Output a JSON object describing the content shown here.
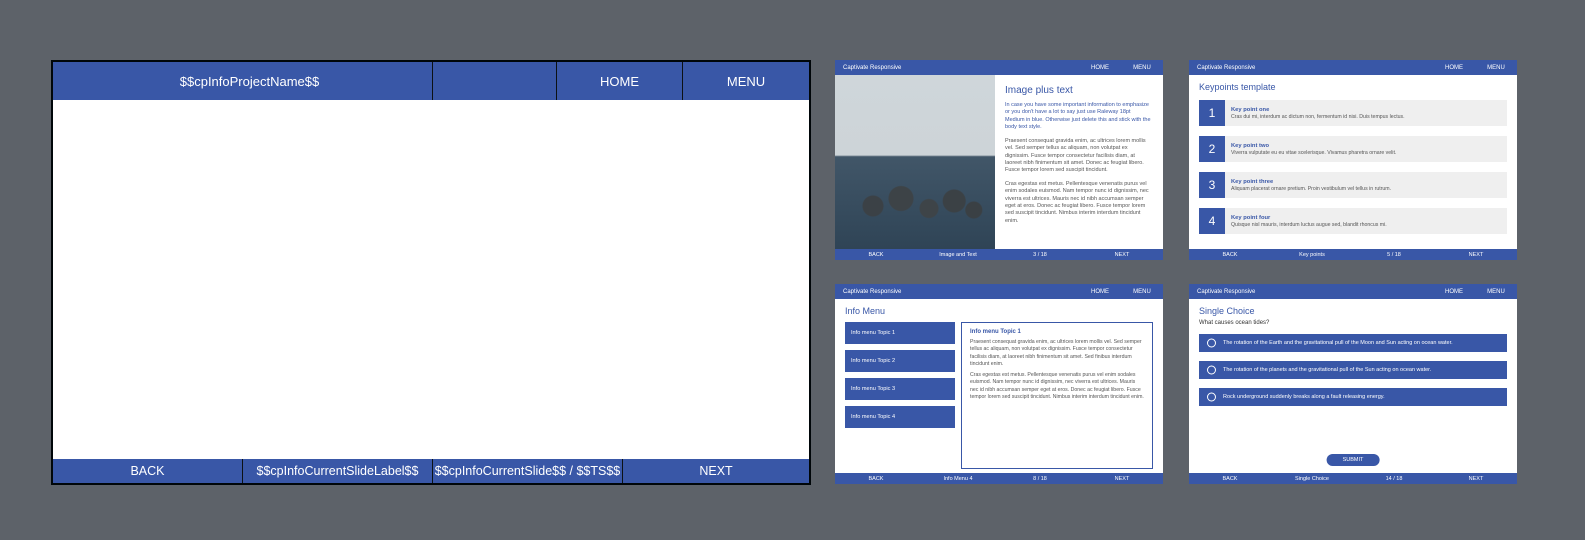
{
  "main": {
    "title": "$$cpInfoProjectName$$",
    "home": "HOME",
    "menu": "MENU",
    "back": "BACK",
    "slide_label": "$$cpInfoCurrentSlideLabel$$",
    "slide_count": "$$cpInfoCurrentSlide$$ / $$TS$$",
    "next": "NEXT"
  },
  "thumb_header": {
    "title": "Captivate Responsive",
    "home": "HOME",
    "menu": "MENU"
  },
  "thumbs": [
    {
      "title": "Image plus text",
      "emph": "In case you have some important information to emphasize or you don't have a lot to say just use Raleway 18pt Medium in blue. Otherwise just delete this and stick with the body text style.",
      "p1": "Praesent consequat gravida enim, ac ultrices lorem mollis vel. Sed semper tellus ac aliquam, non volutpat ex dignissim. Fusce tempor consectetur facilisis diam, at laoreet nibh finimentum sit amet. Donec ac feugiat libero. Fusce tempor lorem sed suscipit tincidunt.",
      "p2": "Cras egestas est metus. Pellentesque venenatis purus vel enim sodales euismod. Nam tempor nunc id dignissim, nec viverra est ultrices. Mauris nec id nibh accumsan semper eget at eros. Donec ac feugiat libero. Fusce tempor lorem sed suscipit tincidunt. Nimbus interim interdum tincidunt enim.",
      "foot_back": "BACK",
      "foot_label": "Image and Text",
      "foot_count": "3 / 18",
      "foot_next": "NEXT"
    },
    {
      "title": "Keypoints template",
      "kp": [
        {
          "num": "1",
          "head": "Key point one",
          "body": "Cras dui mi, interdum ac dictum non, fermentum id nisi. Duis tempus lectus."
        },
        {
          "num": "2",
          "head": "Key point two",
          "body": "Viverra vulputate eu eu vitae scelerisque. Vivamus pharetra ornare velit."
        },
        {
          "num": "3",
          "head": "Key point three",
          "body": "Aliquam placerat ornare pretium. Proin vestibulum vel tellus in rutrum."
        },
        {
          "num": "4",
          "head": "Key point four",
          "body": "Quisque nisl mauris, interdum luctus augue sed, blandit rhoncus mi."
        }
      ],
      "foot_back": "BACK",
      "foot_label": "Key points",
      "foot_count": "5 / 18",
      "foot_next": "NEXT"
    },
    {
      "title": "Info Menu",
      "tabs": [
        "Info menu Topic 1",
        "Info menu Topic 2",
        "Info menu Topic 3",
        "Info menu Topic 4"
      ],
      "pane_title": "Info menu Topic 1",
      "pane_p1": "Praesent consequat gravida enim, ac ultrices lorem mollis vel. Sed semper tellus ac aliquam, non volutpat ex dignissim. Fusce tempor consectetur facilisis diam, at laoreet nibh finimentum sit amet. Sed finibus interdum tincidunt enim.",
      "pane_p2": "Cras egestas est metus. Pellentesque venenatis purus vel enim sodales euismod. Nam tempor nunc id dignissim, nec viverra est ultrices. Mauris nec id nibh accumsan semper eget at eros. Donec ac feugiat libero. Fusce tempor lorem sed suscipit tincidunt. Nimbus interim interdum tincidunt enim.",
      "foot_back": "BACK",
      "foot_label": "Info Menu 4",
      "foot_count": "8 / 18",
      "foot_next": "NEXT"
    },
    {
      "title": "Single Choice",
      "question": "What causes ocean tides?",
      "options": [
        "The rotation of the Earth and the gravitational pull of the Moon and Sun acting on ocean water.",
        "The rotation of the planets and the gravitational pull of the Sun acting on ocean water.",
        "Rock underground suddenly breaks along a fault releasing energy."
      ],
      "submit": "SUBMIT",
      "foot_back": "BACK",
      "foot_label": "Single Choice",
      "foot_count": "14 / 18",
      "foot_next": "NEXT"
    }
  ]
}
